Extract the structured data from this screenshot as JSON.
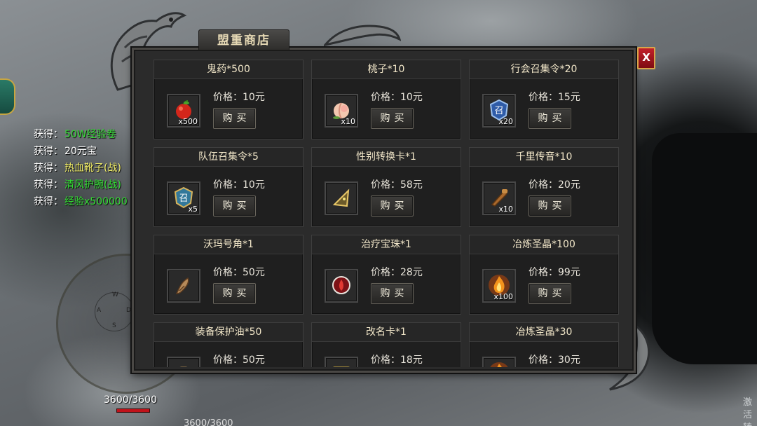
{
  "shop": {
    "title": "盟重商店",
    "close_label": "X",
    "buy_label": "购买",
    "price_prefix": "价格：",
    "items": [
      {
        "name": "鬼药*500",
        "price": "10元",
        "count": "x500",
        "icon": "red-apple-icon"
      },
      {
        "name": "桃子*10",
        "price": "10元",
        "count": "x10",
        "icon": "peach-icon"
      },
      {
        "name": "行会召集令*20",
        "price": "15元",
        "count": "x20",
        "icon": "guild-summon-token-icon"
      },
      {
        "name": "队伍召集令*5",
        "price": "10元",
        "count": "x5",
        "icon": "team-summon-token-icon"
      },
      {
        "name": "性别转换卡*1",
        "price": "58元",
        "count": "",
        "icon": "gender-card-icon"
      },
      {
        "name": "千里传音*10",
        "price": "20元",
        "count": "x10",
        "icon": "horn-scroll-icon"
      },
      {
        "name": "沃玛号角*1",
        "price": "50元",
        "count": "",
        "icon": "woma-horn-icon"
      },
      {
        "name": "治疗宝珠*1",
        "price": "28元",
        "count": "",
        "icon": "healing-orb-icon"
      },
      {
        "name": "冶炼圣晶*100",
        "price": "99元",
        "count": "x100",
        "icon": "flame-crystal-icon"
      },
      {
        "name": "装备保护油*50",
        "price": "50元",
        "count": "",
        "icon": "protection-oil-icon"
      },
      {
        "name": "改名卡*1",
        "price": "18元",
        "count": "",
        "icon": "rename-card-icon"
      },
      {
        "name": "冶炼圣晶*30",
        "price": "30元",
        "count": "",
        "icon": "flame-crystal-icon"
      }
    ]
  },
  "loot_log": [
    {
      "prefix": "获得：",
      "value": "50W经验卷",
      "color": "#33dd33"
    },
    {
      "prefix": "获得：",
      "value": "20元宝",
      "color": "#ffffff"
    },
    {
      "prefix": "获得：",
      "value": "热血靴子(战)",
      "color": "#f3f06a"
    },
    {
      "prefix": "获得：",
      "value": "清风护腕(战)",
      "color": "#33dd33"
    },
    {
      "prefix": "获得：",
      "value": "经验x500000",
      "color": "#33dd33"
    }
  ],
  "joystick": {
    "w": "W",
    "a": "A",
    "s": "S",
    "d": "D"
  },
  "player": {
    "hp": "3600/3600",
    "hp_fraction": 1.0,
    "hp2": "3600/3600"
  },
  "corner": {
    "text": "激活转"
  },
  "colors": {
    "accent": "#c2202a",
    "panel": "#1f1f1f",
    "title_text": "#f2e7c9"
  }
}
